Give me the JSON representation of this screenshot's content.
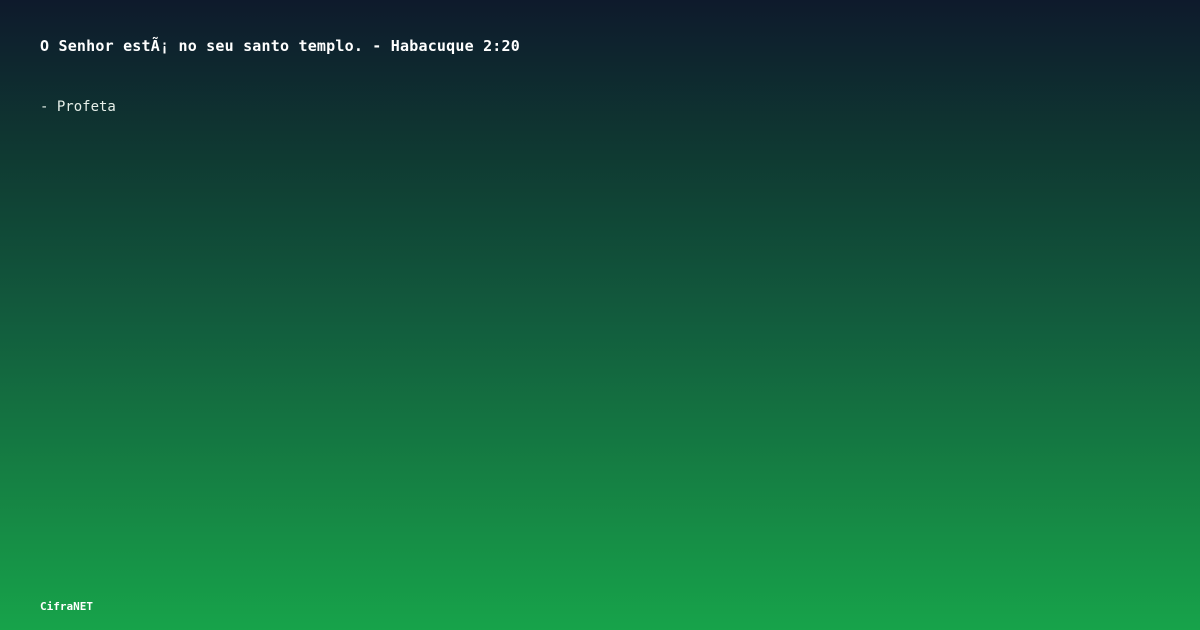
{
  "quote": {
    "text": "O Senhor estÃ¡ no seu santo templo. - Habacuque 2:20"
  },
  "attribution": {
    "text": "- Profeta"
  },
  "brand": {
    "name": "CifraNET"
  },
  "colors": {
    "gradient_top": "#0e1a2c",
    "gradient_bottom": "#17a34a",
    "text": "#ffffff"
  }
}
